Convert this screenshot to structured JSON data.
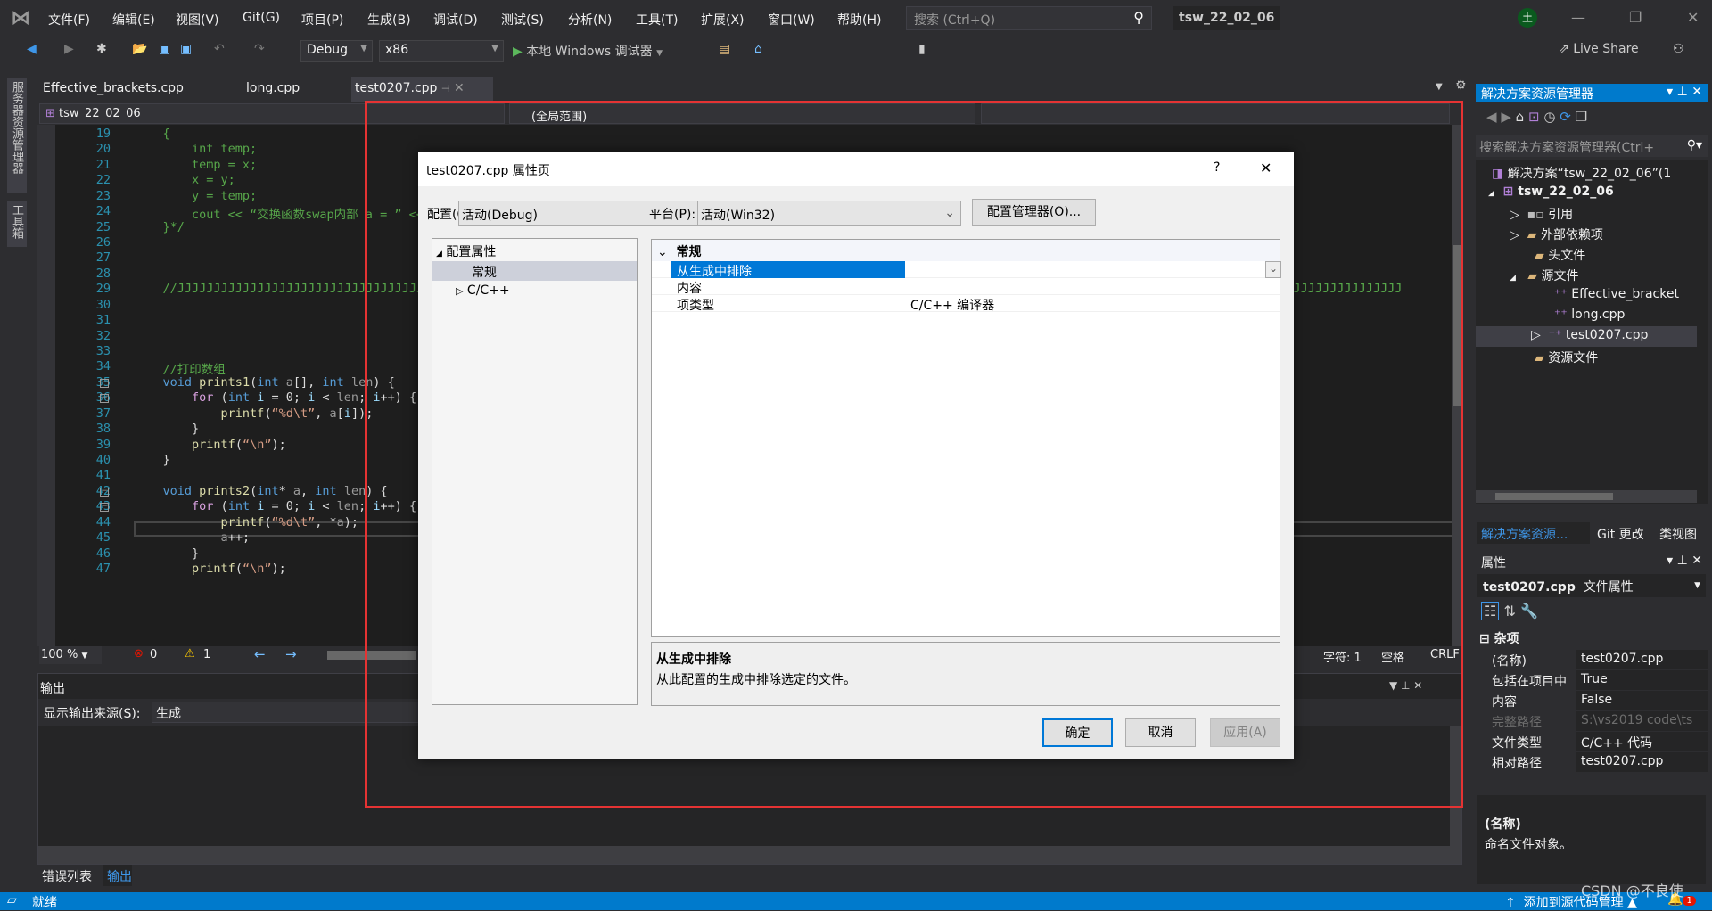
{
  "menubar": {
    "items": [
      "文件(F)",
      "编辑(E)",
      "视图(V)",
      "Git(G)",
      "项目(P)",
      "生成(B)",
      "调试(D)",
      "测试(S)",
      "分析(N)",
      "工具(T)",
      "扩展(X)",
      "窗口(W)",
      "帮助(H)"
    ],
    "search_placeholder": "搜索 (Ctrl+Q)",
    "project_title": "tsw_22_02_06",
    "avatar": "土"
  },
  "toolbar": {
    "config": "Debug",
    "platform": "x86",
    "run_label": "本地 Windows 调试器",
    "live_share": "Live Share"
  },
  "left_strip": {
    "server_explorer": "服务器资源管理器",
    "toolbox": "工具箱"
  },
  "tabs": [
    {
      "label": "Effective_brackets.cpp"
    },
    {
      "label": "long.cpp"
    },
    {
      "label": "test0207.cpp",
      "active": true
    }
  ],
  "navbar": {
    "project": "tsw_22_02_06",
    "scope": "(全局范围)"
  },
  "editor": {
    "lines": [
      {
        "n": "19",
        "t": [
          [
            "cm",
            "    {"
          ]
        ]
      },
      {
        "n": "20",
        "t": [
          [
            "cm",
            "        int temp;"
          ]
        ]
      },
      {
        "n": "21",
        "t": [
          [
            "cm",
            "        temp = x;"
          ]
        ]
      },
      {
        "n": "22",
        "t": [
          [
            "cm",
            "        x = y;"
          ]
        ]
      },
      {
        "n": "23",
        "t": [
          [
            "cm",
            "        y = temp;"
          ]
        ]
      },
      {
        "n": "24",
        "t": [
          [
            "cm",
            "        cout << “交换函数swap内部 a = ” << &"
          ]
        ]
      },
      {
        "n": "25",
        "t": [
          [
            "cm",
            "    }*/"
          ]
        ]
      },
      {
        "n": "26",
        "t": []
      },
      {
        "n": "27",
        "t": []
      },
      {
        "n": "28",
        "t": []
      },
      {
        "n": "29",
        "t": [
          [
            "cm",
            "    //JJJJJJJJJJJJJJJJJJJJJJJJJJJJJJJJJJJJJJJJJJJJJJJJJJJJJJJJJJJJJJJJJJJJJJJJJJJJJJJJJJJJJJJJJJJJJJJJJJJJJJJJJJJJJJJJJJJJJJJJJJJJJJJJJJJJJJJJJJJJJJJJJJJJJJJJJJJJJJJJJJJJJJJJJ"
          ]
        ]
      },
      {
        "n": "30",
        "t": []
      },
      {
        "n": "31",
        "t": []
      },
      {
        "n": "32",
        "t": []
      },
      {
        "n": "33",
        "t": []
      },
      {
        "n": "34",
        "t": [
          [
            "cm",
            "    //打印数组"
          ]
        ]
      },
      {
        "n": "35",
        "fold": true,
        "t": [
          [
            "pl",
            "    "
          ],
          [
            "kw",
            "void"
          ],
          [
            "pl",
            " "
          ],
          [
            "fn",
            "prints1"
          ],
          [
            "pl",
            "("
          ],
          [
            "kw",
            "int"
          ],
          [
            "pl",
            " "
          ],
          [
            "par",
            "a"
          ],
          [
            "pl",
            "[], "
          ],
          [
            "kw",
            "int"
          ],
          [
            "pl",
            " "
          ],
          [
            "par",
            "len"
          ],
          [
            "pl",
            ") {"
          ]
        ]
      },
      {
        "n": "36",
        "fold": true,
        "t": [
          [
            "pl",
            "        "
          ],
          [
            "ctl",
            "for"
          ],
          [
            "pl",
            " ("
          ],
          [
            "kw",
            "int"
          ],
          [
            "pl",
            " "
          ],
          [
            "var",
            "i"
          ],
          [
            "pl",
            " = 0; "
          ],
          [
            "var",
            "i"
          ],
          [
            "pl",
            " < "
          ],
          [
            "par",
            "len"
          ],
          [
            "pl",
            "; "
          ],
          [
            "var",
            "i"
          ],
          [
            "pl",
            "++) {"
          ]
        ]
      },
      {
        "n": "37",
        "t": [
          [
            "pl",
            "            "
          ],
          [
            "fn",
            "printf"
          ],
          [
            "pl",
            "("
          ],
          [
            "str",
            "“%d\\t”"
          ],
          [
            "pl",
            ", "
          ],
          [
            "par",
            "a"
          ],
          [
            "pl",
            "["
          ],
          [
            "var",
            "i"
          ],
          [
            "pl",
            "]);"
          ]
        ]
      },
      {
        "n": "38",
        "t": [
          [
            "pl",
            "        }"
          ]
        ]
      },
      {
        "n": "39",
        "t": [
          [
            "pl",
            "        "
          ],
          [
            "fn",
            "printf"
          ],
          [
            "pl",
            "("
          ],
          [
            "str",
            "“\\n”"
          ],
          [
            "pl",
            ");"
          ]
        ]
      },
      {
        "n": "40",
        "t": [
          [
            "pl",
            "    }"
          ]
        ]
      },
      {
        "n": "41",
        "t": []
      },
      {
        "n": "42",
        "fold": true,
        "t": [
          [
            "pl",
            "    "
          ],
          [
            "kw",
            "void"
          ],
          [
            "pl",
            " "
          ],
          [
            "fn",
            "prints2"
          ],
          [
            "pl",
            "("
          ],
          [
            "kw",
            "int"
          ],
          [
            "pl",
            "* "
          ],
          [
            "par",
            "a"
          ],
          [
            "pl",
            ", "
          ],
          [
            "kw",
            "int"
          ],
          [
            "pl",
            " "
          ],
          [
            "par",
            "len"
          ],
          [
            "pl",
            ") {"
          ]
        ]
      },
      {
        "n": "43",
        "fold": true,
        "t": [
          [
            "pl",
            "        "
          ],
          [
            "ctl",
            "for"
          ],
          [
            "pl",
            " ("
          ],
          [
            "kw",
            "int"
          ],
          [
            "pl",
            " "
          ],
          [
            "var",
            "i"
          ],
          [
            "pl",
            " = 0; "
          ],
          [
            "var",
            "i"
          ],
          [
            "pl",
            " < "
          ],
          [
            "par",
            "len"
          ],
          [
            "pl",
            "; "
          ],
          [
            "var",
            "i"
          ],
          [
            "pl",
            "++) {"
          ]
        ]
      },
      {
        "n": "44",
        "t": [
          [
            "pl",
            "            "
          ],
          [
            "fn",
            "printf"
          ],
          [
            "pl",
            "("
          ],
          [
            "str",
            "“%d\\t”"
          ],
          [
            "pl",
            ", *"
          ],
          [
            "par",
            "a"
          ],
          [
            "pl",
            ");"
          ]
        ]
      },
      {
        "n": "45",
        "t": [
          [
            "pl",
            "            "
          ],
          [
            "par",
            "a"
          ],
          [
            "pl",
            "++;"
          ]
        ]
      },
      {
        "n": "46",
        "t": [
          [
            "pl",
            "        }"
          ]
        ]
      },
      {
        "n": "47",
        "t": [
          [
            "pl",
            "        "
          ],
          [
            "fn",
            "printf"
          ],
          [
            "pl",
            "("
          ],
          [
            "str",
            "“\\n”"
          ],
          [
            "pl",
            ");"
          ]
        ]
      }
    ]
  },
  "editor_status": {
    "zoom": "100 %",
    "errors": "0",
    "warnings": "1",
    "char": "字符: 1",
    "spaces": "空格",
    "eol": "CRLF"
  },
  "output": {
    "title": "输出",
    "source_label": "显示输出来源(S):",
    "source_value": "生成"
  },
  "bottom_tabs": [
    "错误列表",
    "输出"
  ],
  "statusbar": {
    "ready": "就绪",
    "source_control": "添加到源代码管理",
    "notifications": "1",
    "watermark": "CSDN @不良使"
  },
  "solution_explorer": {
    "title": "解决方案资源管理器",
    "search_placeholder": "搜索解决方案资源管理器(Ctrl+",
    "items": [
      {
        "label": "解决方案“tsw_22_02_06”(1"
      },
      {
        "label": "tsw_22_02_06"
      },
      {
        "label": "引用"
      },
      {
        "label": "外部依赖项"
      },
      {
        "label": "头文件"
      },
      {
        "label": "源文件"
      },
      {
        "label": "Effective_bracket"
      },
      {
        "label": "long.cpp"
      },
      {
        "label": "test0207.cpp",
        "selected": true
      },
      {
        "label": "资源文件"
      }
    ],
    "tabs": [
      "解决方案资源...",
      "Git 更改",
      "类视图"
    ]
  },
  "properties": {
    "title": "属性",
    "object": "test0207.cpp",
    "object_type": "文件属性",
    "category": "杂项",
    "rows": [
      {
        "k": "(名称)",
        "v": "test0207.cpp"
      },
      {
        "k": "包括在项目中",
        "v": "True"
      },
      {
        "k": "内容",
        "v": "False"
      },
      {
        "k": "完整路径",
        "v": "S:\\vs2019 code\\ts",
        "disabled": true
      },
      {
        "k": "文件类型",
        "v": "C/C++ 代码"
      },
      {
        "k": "相对路径",
        "v": "test0207.cpp"
      }
    ],
    "desc_title": "(名称)",
    "desc_text": "命名文件对象。"
  },
  "dialog": {
    "title": "test0207.cpp 属性页",
    "help": "?",
    "config_label": "配置(C):",
    "config_value": "活动(Debug)",
    "platform_label": "平台(P):",
    "platform_value": "活动(Win32)",
    "config_manager": "配置管理器(O)...",
    "tree": {
      "root": "配置属性",
      "general": "常规",
      "cpp": "C/C++"
    },
    "grid": {
      "section": "常规",
      "rows": [
        {
          "k": "从生成中排除",
          "v": "",
          "selected": true
        },
        {
          "k": "内容",
          "v": ""
        },
        {
          "k": "项类型",
          "v": "C/C++ 编译器"
        }
      ]
    },
    "desc_title": "从生成中排除",
    "desc_text": "从此配置的生成中排除选定的文件。",
    "ok": "确定",
    "cancel": "取消",
    "apply": "应用(A)"
  },
  "colors": {
    "accent": "#007acc",
    "highlight_box": "#e53333",
    "selection": "#0078d7"
  }
}
